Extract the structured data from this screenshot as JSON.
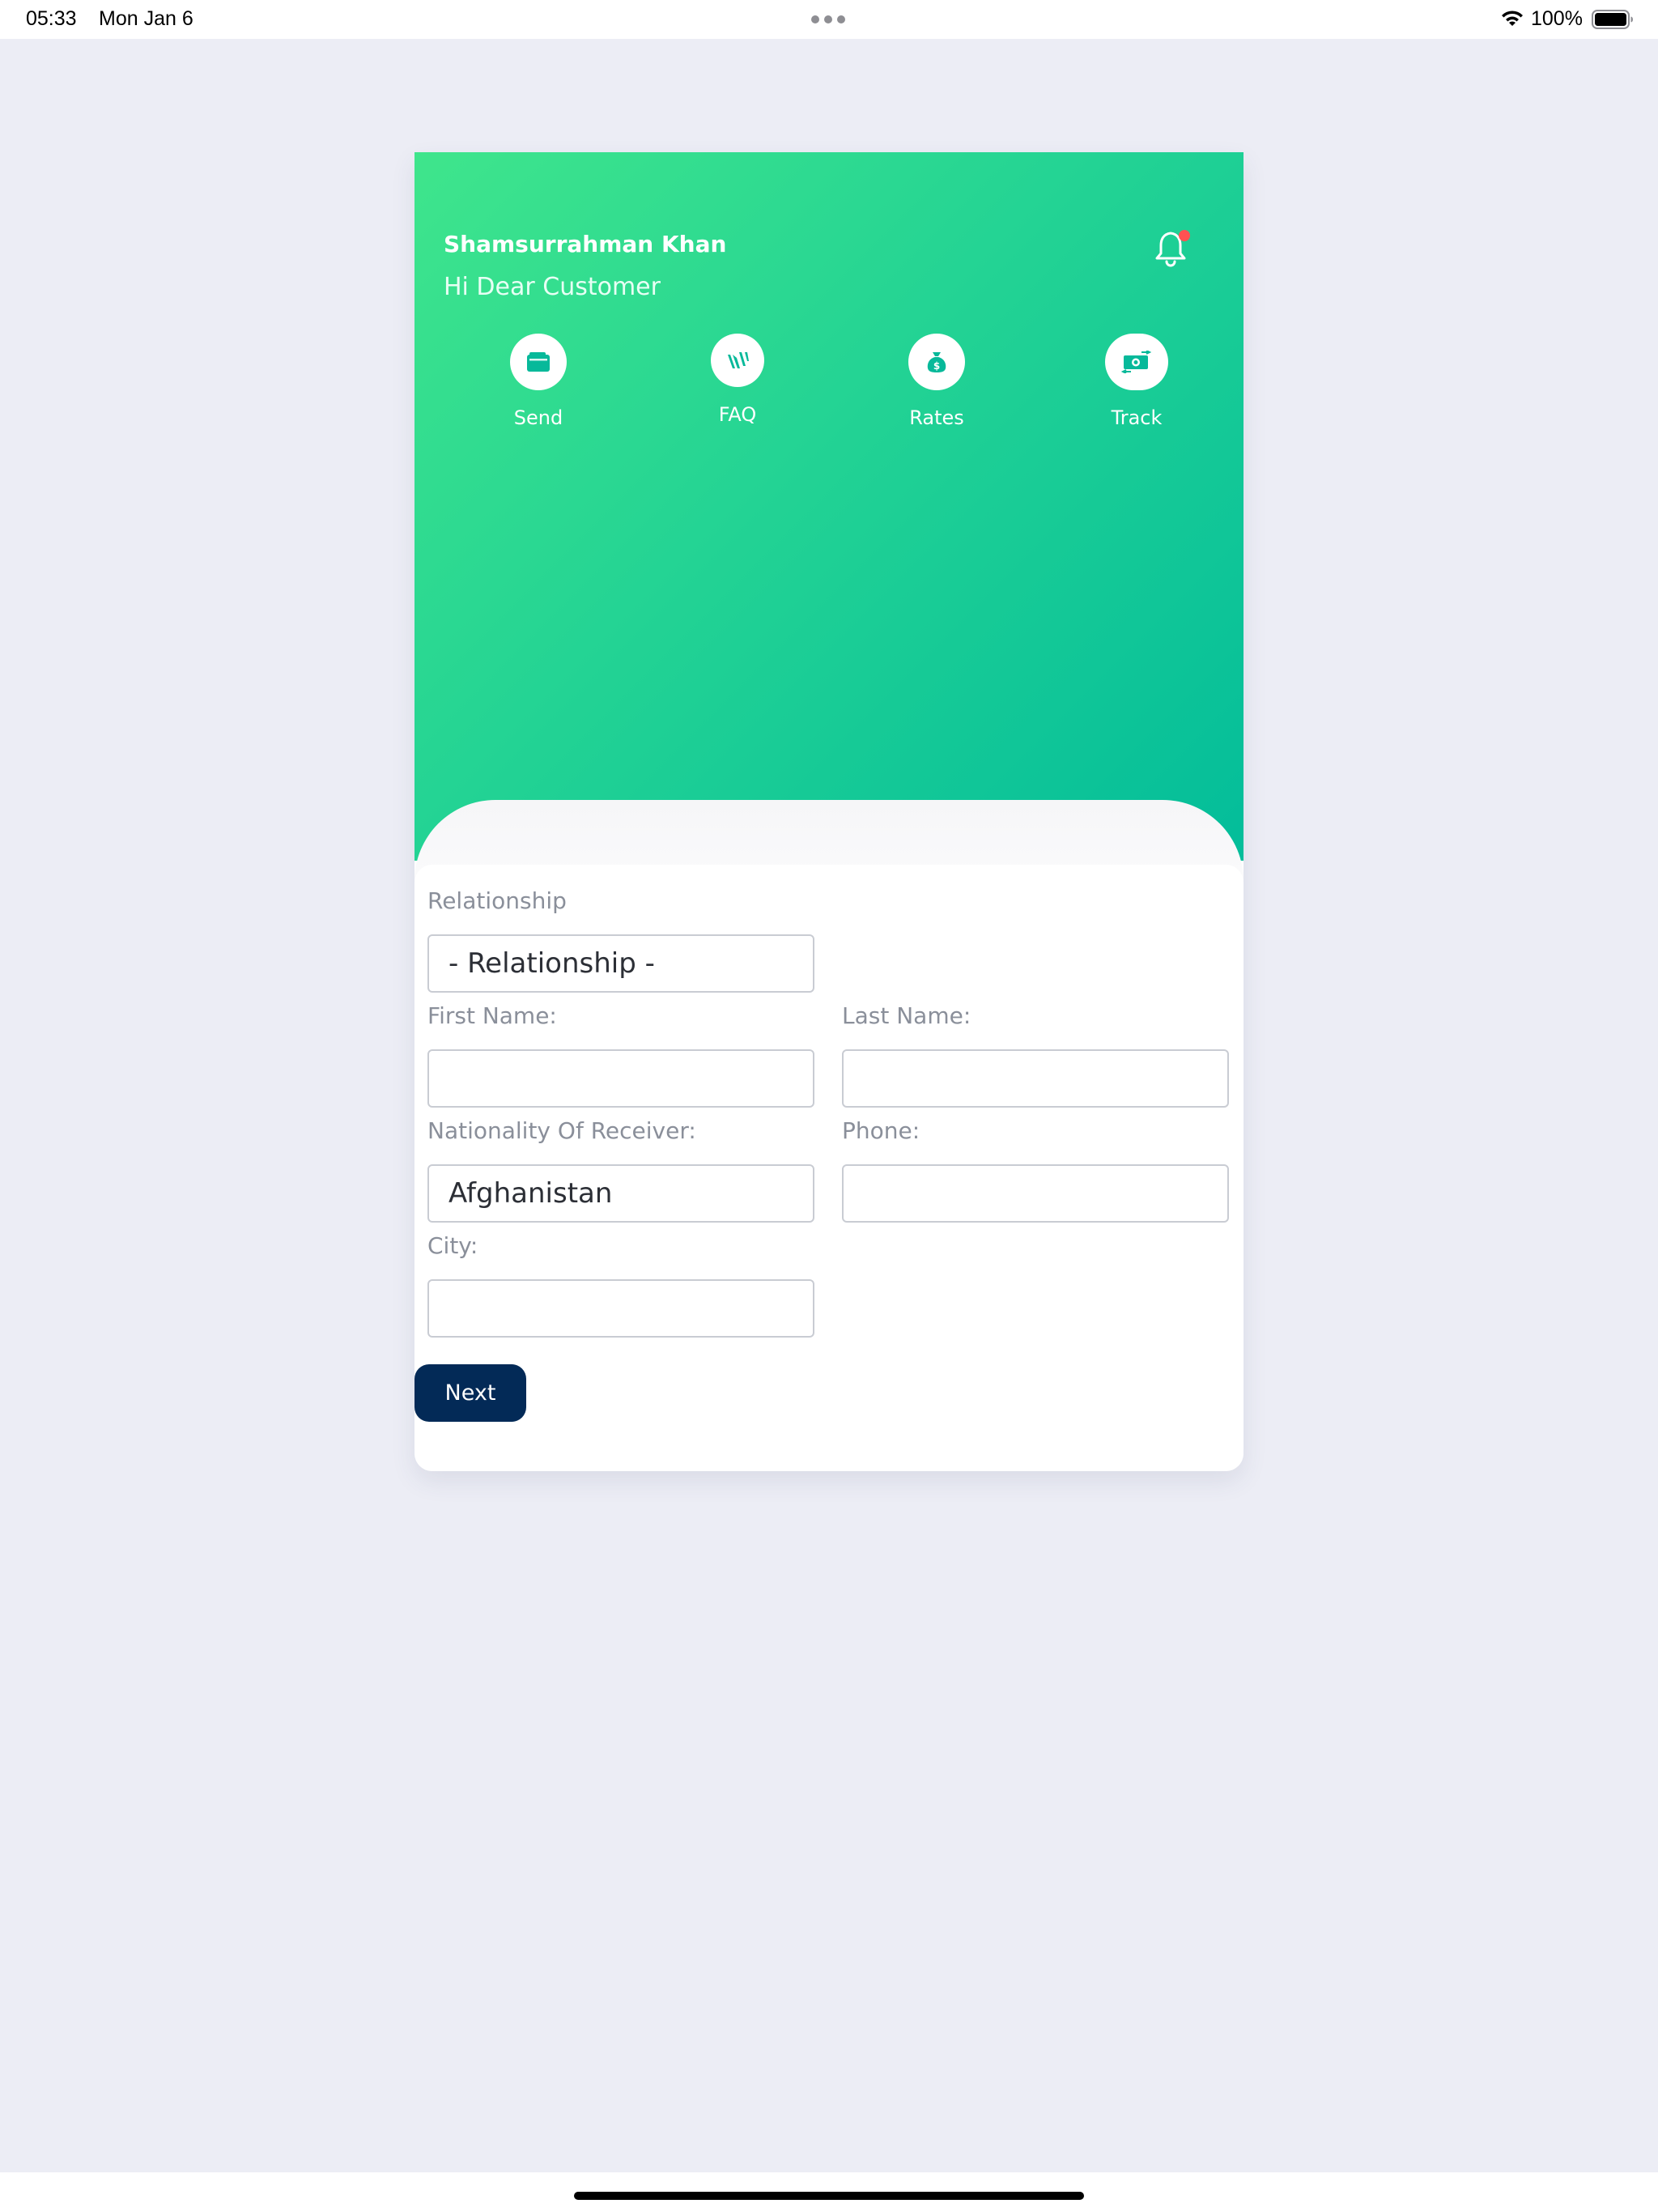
{
  "status_bar": {
    "time": "05:33",
    "date": "Mon Jan 6",
    "battery": "100%"
  },
  "header": {
    "user_name": "Shamsurrahman Khan",
    "greeting": "Hi Dear Customer"
  },
  "actions": [
    {
      "label": "Send",
      "icon": "wallet-icon"
    },
    {
      "label": "FAQ",
      "icon": "faq-icon"
    },
    {
      "label": "Rates",
      "icon": "money-bag-icon"
    },
    {
      "label": "Track",
      "icon": "money-transfer-icon"
    }
  ],
  "form": {
    "relationship_label": "Relationship",
    "relationship_value": "- Relationship -",
    "first_name_label": "First Name:",
    "first_name_value": "",
    "last_name_label": "Last Name:",
    "last_name_value": "",
    "nationality_label": "Nationality Of Receiver:",
    "nationality_value": "Afghanistan",
    "phone_label": "Phone:",
    "phone_value": "",
    "city_label": "City:",
    "city_value": "",
    "next_label": "Next"
  },
  "colors": {
    "gradient_start": "#3fe58c",
    "gradient_end": "#03bd9a",
    "accent_icon": "#07b99a",
    "next_button": "#032a57",
    "notification_dot": "#ff5252",
    "background": "#ecedf5"
  }
}
